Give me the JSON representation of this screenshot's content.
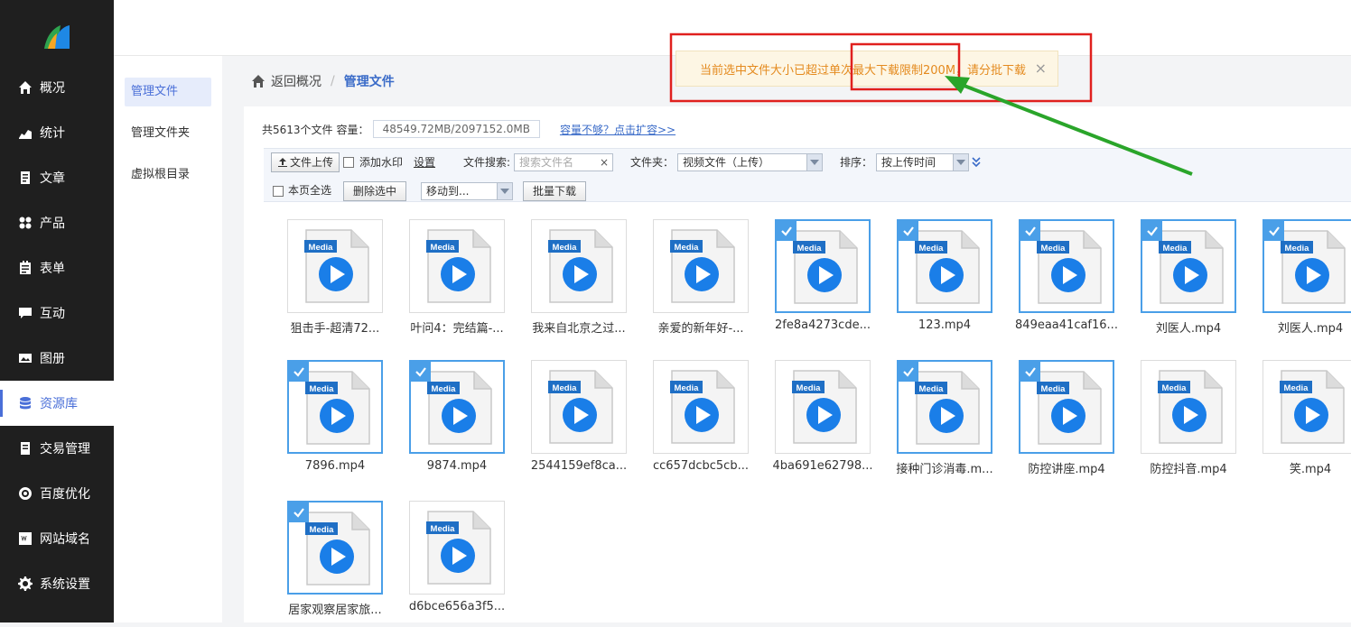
{
  "sidebar": {
    "items": [
      {
        "label": "概况",
        "icon": "home-icon",
        "active": false
      },
      {
        "label": "统计",
        "icon": "chart-icon",
        "active": false
      },
      {
        "label": "文章",
        "icon": "article-icon",
        "active": false
      },
      {
        "label": "产品",
        "icon": "grid-icon",
        "active": false
      },
      {
        "label": "表单",
        "icon": "form-icon",
        "active": false
      },
      {
        "label": "互动",
        "icon": "chat-icon",
        "active": false
      },
      {
        "label": "图册",
        "icon": "album-icon",
        "active": false
      },
      {
        "label": "资源库",
        "icon": "database-icon",
        "active": true
      },
      {
        "label": "交易管理",
        "icon": "trade-icon",
        "active": false
      },
      {
        "label": "百度优化",
        "icon": "seo-icon",
        "active": false
      },
      {
        "label": "网站域名",
        "icon": "domain-icon",
        "active": false
      },
      {
        "label": "系统设置",
        "icon": "gear-icon",
        "active": false
      }
    ]
  },
  "subnav": {
    "items": [
      {
        "label": "管理文件",
        "active": true
      },
      {
        "label": "管理文件夹",
        "active": false
      },
      {
        "label": "虚拟根目录",
        "active": false
      }
    ]
  },
  "breadcrumb": {
    "back": "返回概况",
    "sep": "/",
    "current": "管理文件"
  },
  "stats": {
    "count_label": "共5613个文件",
    "capacity_label": "容量：",
    "capacity_value": "48549.72MB/2097152.0MB",
    "expand_link": "容量不够？点击扩容>>"
  },
  "toolbar": {
    "upload": "文件上传",
    "watermark": "添加水印",
    "settings": "设置",
    "search_label": "文件搜索:",
    "search_placeholder": "搜索文件名",
    "search_clear": "×",
    "folder_label": "文件夹：",
    "folder_value": "视频文件（上传）",
    "sort_label": "排序：",
    "sort_value": "按上传时间",
    "select_all": "本页全选",
    "delete_selected": "删除选中",
    "move_to": "移动到...",
    "batch_download": "批量下载"
  },
  "alert": {
    "message": "当前选中文件大小已超过单次最大下载限制200M，请分批下载",
    "close": "×",
    "color": "#e48a1e"
  },
  "files": [
    {
      "name": "狙击手-超清72...",
      "selected": false
    },
    {
      "name": "叶问4：完结篇-...",
      "selected": false
    },
    {
      "name": "我来自北京之过...",
      "selected": false
    },
    {
      "name": "亲爱的新年好-...",
      "selected": false
    },
    {
      "name": "2fe8a4273cde...",
      "selected": true
    },
    {
      "name": "123.mp4",
      "selected": true
    },
    {
      "name": "849eaa41caf16...",
      "selected": true
    },
    {
      "name": "刘医人.mp4",
      "selected": true
    },
    {
      "name": "刘医人.mp4",
      "selected": true
    },
    {
      "name": "7896.mp4",
      "selected": true
    },
    {
      "name": "9874.mp4",
      "selected": true
    },
    {
      "name": "2544159ef8ca...",
      "selected": false
    },
    {
      "name": "cc657dcbc5cb...",
      "selected": false
    },
    {
      "name": "4ba691e62798...",
      "selected": false
    },
    {
      "name": "接种门诊消毒.m...",
      "selected": true
    },
    {
      "name": "防控讲座.mp4",
      "selected": true
    },
    {
      "name": "防控抖音.mp4",
      "selected": false
    },
    {
      "name": "笑.mp4",
      "selected": false
    },
    {
      "name": "居家观察居家旅...",
      "selected": true
    },
    {
      "name": "d6bce656a3f5...",
      "selected": false
    }
  ],
  "media_badge": "Media",
  "colors": {
    "accent": "#4a6fd8",
    "selection": "#4a9fe8",
    "annotation_box": "#e0201e",
    "annotation_arrow": "#2aa52a"
  }
}
